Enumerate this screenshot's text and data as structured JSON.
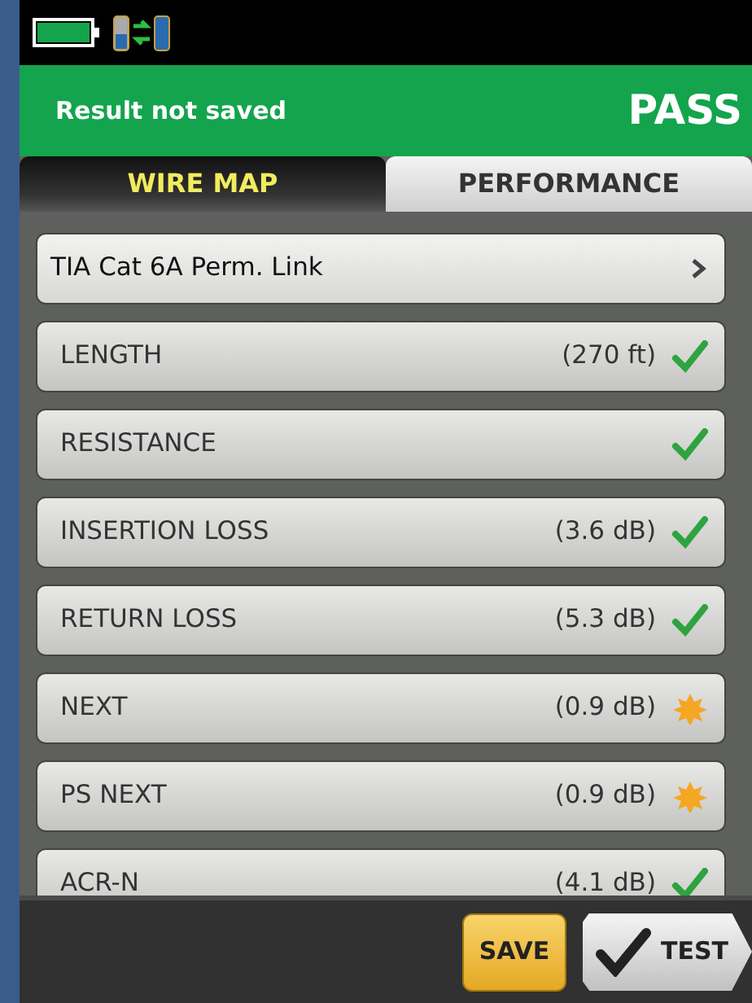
{
  "header": {
    "message": "Result not saved",
    "result": "PASS"
  },
  "tabs": [
    {
      "label": "WIRE MAP",
      "selected": true
    },
    {
      "label": "PERFORMANCE",
      "selected": false
    }
  ],
  "limit": {
    "label": "TIA Cat 6A Perm. Link"
  },
  "tests": [
    {
      "name": "LENGTH",
      "value": "(270 ft)",
      "kind": "pass"
    },
    {
      "name": "RESISTANCE",
      "kind": "pass"
    },
    {
      "name": "INSERTION LOSS",
      "value": "(3.6 dB)",
      "kind": "pass"
    },
    {
      "name": "RETURN LOSS",
      "value": "(5.3 dB)",
      "kind": "pass"
    },
    {
      "name": "NEXT",
      "value": "(0.9 dB)",
      "kind": "marginal"
    },
    {
      "name": "PS NEXT",
      "value": "(0.9 dB)",
      "kind": "marginal"
    },
    {
      "name": "ACR-N",
      "value": "(4.1 dB)",
      "kind": "pass"
    }
  ],
  "buttons": [
    {
      "label": "SAVE",
      "kind": "save"
    },
    {
      "label": "TEST",
      "kind": "test"
    }
  ]
}
